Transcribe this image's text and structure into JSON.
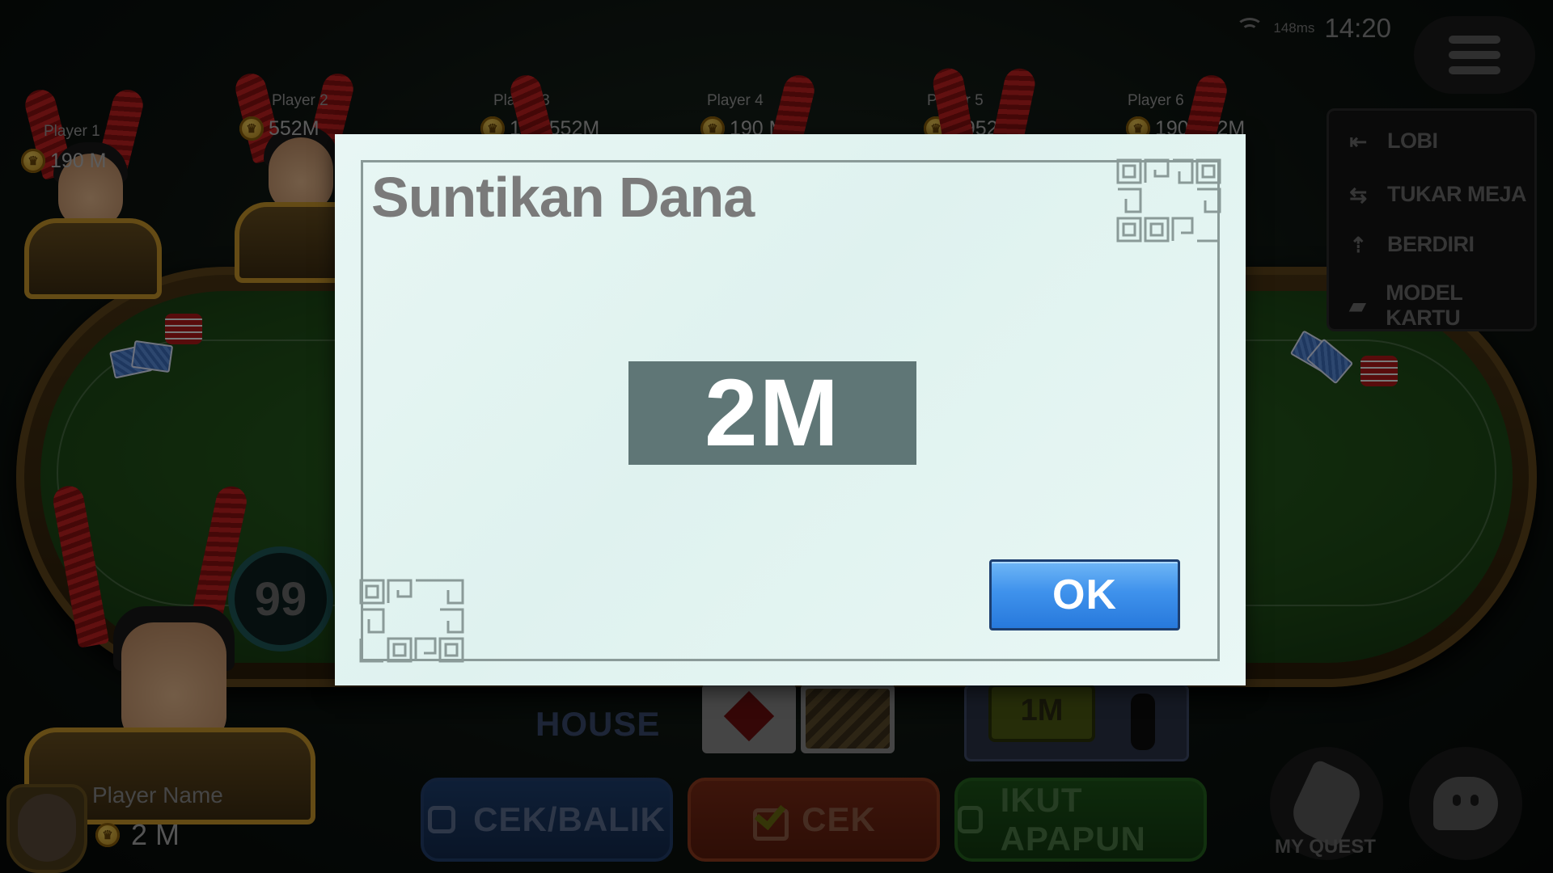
{
  "status_bar": {
    "ping": "148ms",
    "time": "14:20"
  },
  "players": [
    {
      "name": "Player 1",
      "chips": "190 M"
    },
    {
      "name": "Player 2",
      "chips": "552M"
    },
    {
      "name": "Player 3",
      "chips": "190.552M"
    },
    {
      "name": "Player 4",
      "chips": "190 M"
    },
    {
      "name": "Player 5",
      "chips": "1952 M"
    },
    {
      "name": "Player 6",
      "chips": "190.552M"
    }
  ],
  "side_menu": [
    {
      "label": "LOBI",
      "icon": "exit-door-icon"
    },
    {
      "label": "TUKAR MEJA",
      "icon": "swap-arrows-icon"
    },
    {
      "label": "BERDIRI",
      "icon": "stand-up-icon"
    },
    {
      "label": "MODEL KARTU",
      "icon": "card-style-icon"
    }
  ],
  "self": {
    "name": "Player Name",
    "chips": "2 M",
    "timer": "99"
  },
  "table": {
    "house_label": "HOUSE",
    "bet_chip": "1M"
  },
  "actions": [
    {
      "label": "CEK/BALIK",
      "color": "#1d3e6e"
    },
    {
      "label": "CEK",
      "color": "#7a2a16"
    },
    {
      "label": "IKUT APAPUN",
      "color": "#1c5418"
    }
  ],
  "quest_label": "MY QUEST",
  "dialog": {
    "title": "Suntikan Dana",
    "amount": "2M",
    "ok_label": "OK",
    "accent_color": "#3f92ec"
  }
}
